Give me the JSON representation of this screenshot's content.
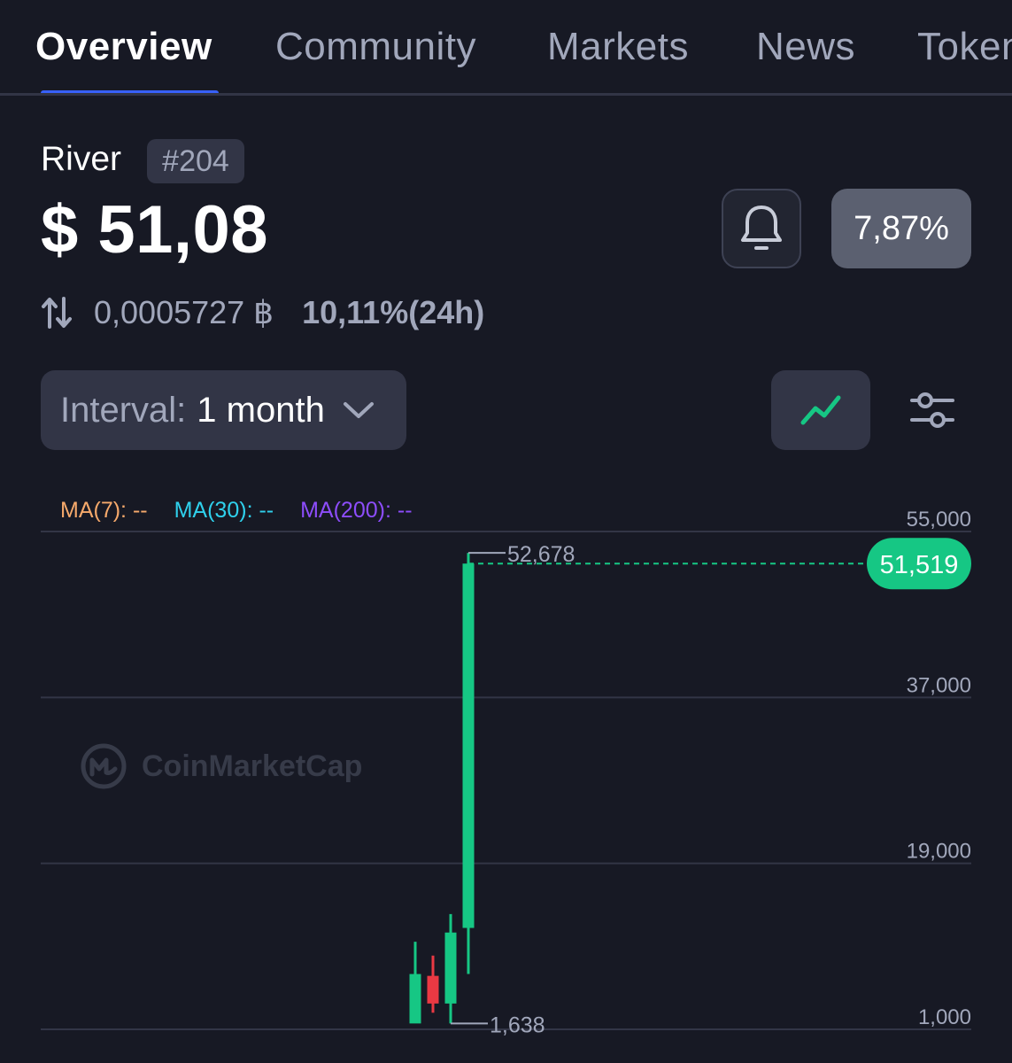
{
  "tabs": [
    {
      "label": "Overview",
      "active": true
    },
    {
      "label": "Community",
      "active": false
    },
    {
      "label": "Markets",
      "active": false
    },
    {
      "label": "News",
      "active": false
    },
    {
      "label": "Tokenomics",
      "active": false
    }
  ],
  "coin": {
    "name": "River",
    "rank": "#204",
    "price": "$ 51,08",
    "change": "7,87%",
    "btc_price": "0,0005727 ฿",
    "btc_change": "10,11%(24h)"
  },
  "controls": {
    "interval_label": "Interval:",
    "interval_value": "1 month"
  },
  "colors": {
    "background": "#171924",
    "up": "#16c784",
    "down": "#ea3943",
    "accent": "#3861fb",
    "ma7": "#f6a96b",
    "ma30": "#2fd0ec",
    "ma200": "#8d4dfb"
  },
  "chart_data": {
    "type": "candlestick",
    "ma_legend": [
      {
        "label": "MA(7): --",
        "color": "#f6a96b"
      },
      {
        "label": "MA(30): --",
        "color": "#2fd0ec"
      },
      {
        "label": "MA(200): --",
        "color": "#8d4dfb"
      }
    ],
    "y_ticks": [
      55000,
      37000,
      19000,
      1000
    ],
    "y_tick_labels": [
      "55,000",
      "37,000",
      "19,000",
      "1,000"
    ],
    "ylim": [
      1000,
      55000
    ],
    "candles": [
      {
        "open": 1638,
        "high": 10500,
        "low": 1800,
        "close": 7000
      },
      {
        "open": 6800,
        "high": 9000,
        "low": 2800,
        "close": 3800
      },
      {
        "open": 3800,
        "high": 13500,
        "low": 1638,
        "close": 11500
      },
      {
        "open": 12000,
        "high": 52678,
        "low": 7000,
        "close": 51519
      }
    ],
    "high_label": "52,678",
    "low_label": "1,638",
    "last_price": 51519,
    "last_price_label": "51,519",
    "watermark": "CoinMarketCap"
  }
}
